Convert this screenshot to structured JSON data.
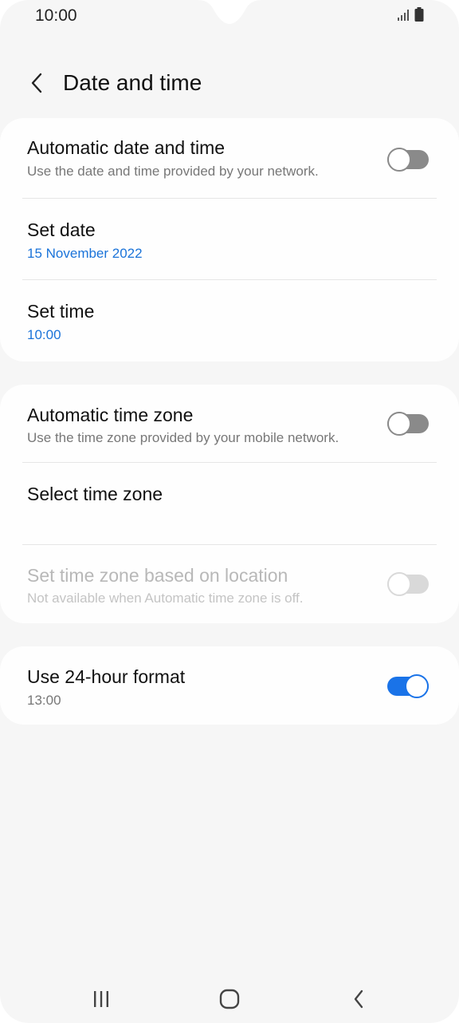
{
  "status_bar": {
    "time": "10:00",
    "icons": [
      "signal-icon",
      "battery-icon"
    ]
  },
  "header": {
    "back_icon": "chevron-left-icon",
    "title": "Date and time"
  },
  "settings": {
    "auto_date_time": {
      "label": "Automatic date and time",
      "sub": "Use the date and time provided by your network.",
      "enabled": false
    },
    "set_date": {
      "label": "Set date",
      "value": "15 November 2022"
    },
    "set_time": {
      "label": "Set time",
      "value": "10:00"
    },
    "auto_time_zone": {
      "label": "Automatic time zone",
      "sub": "Use the time zone provided by your mobile network.",
      "enabled": false
    },
    "select_time_zone": {
      "label": "Select time zone"
    },
    "tz_location": {
      "label": "Set time zone based on location",
      "sub": "Not available when Automatic time zone is off.",
      "enabled": false,
      "disabled": true
    },
    "use_24_hour": {
      "label": "Use 24-hour format",
      "sub": "13:00",
      "enabled": true
    }
  },
  "colors": {
    "accent": "#1a73e8",
    "link_blue": "#1a73d9",
    "background": "#f6f6f6",
    "card": "#fefefe",
    "toggle_off": "#8a8a8a",
    "toggle_disabled": "#d9d9d9"
  },
  "nav_bar": {
    "icons": [
      "recent-apps-icon",
      "home-icon",
      "back-icon"
    ]
  }
}
